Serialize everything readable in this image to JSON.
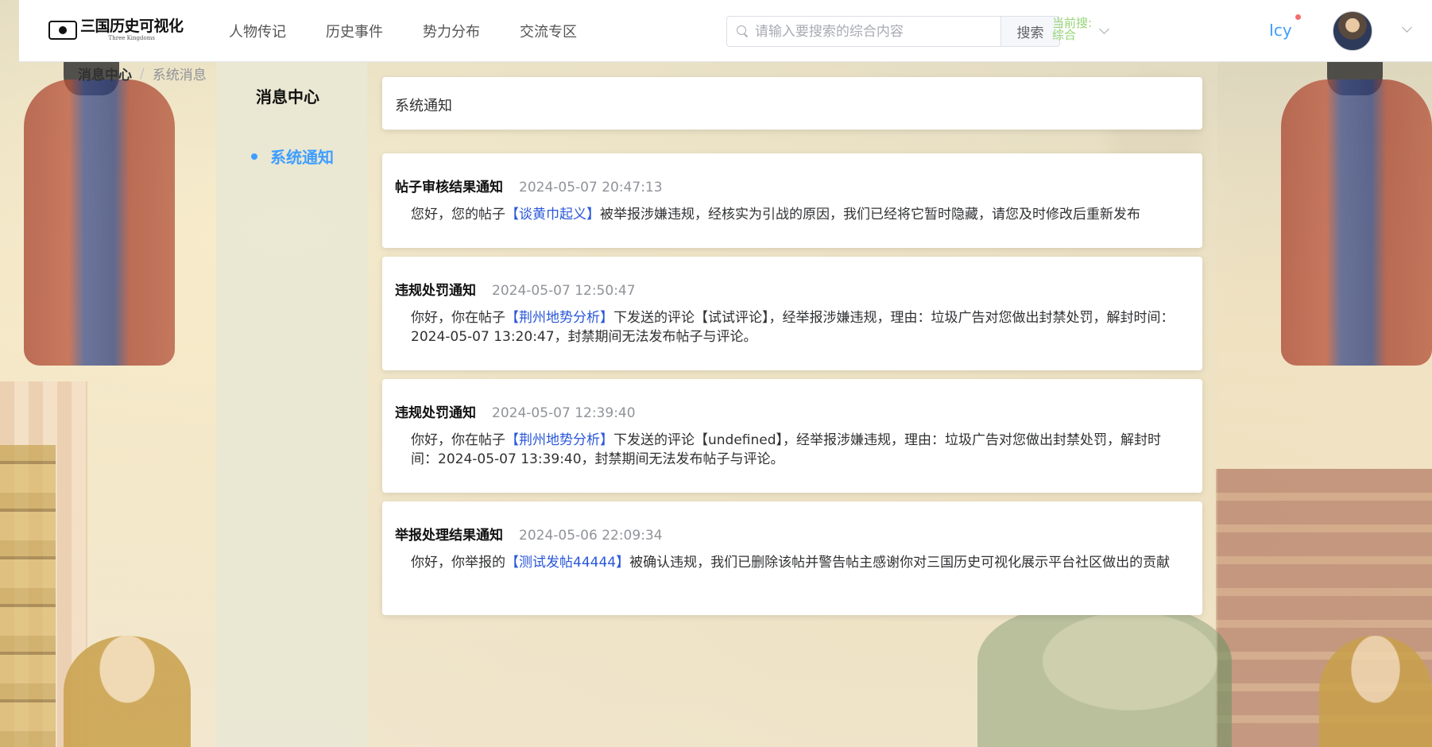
{
  "header": {
    "logo_text": "三国历史可视化",
    "logo_sub": "Three Kingdoms",
    "nav": [
      "人物传记",
      "历史事件",
      "势力分布",
      "交流专区"
    ],
    "search": {
      "placeholder": "请输入要搜索的综合内容",
      "button_label": "搜索",
      "scope_label": "当前搜:",
      "scope_value": "综合"
    },
    "username": "Icy"
  },
  "breadcrumb": [
    "消息中心",
    "系统消息"
  ],
  "breadcrumb_sep": "/",
  "sidebar": {
    "title": "消息中心",
    "items": [
      {
        "label": "系统通知",
        "active": true
      }
    ]
  },
  "main": {
    "title": "系统通知",
    "notices": [
      {
        "title": "帖子审核结果通知",
        "time": "2024-05-07 20:47:13",
        "pre": "您好，您的帖子",
        "link": "【谈黄巾起义】",
        "post": "被举报涉嫌违规，经核实为引战的原因，我们已经将它暂时隐藏，请您及时修改后重新发布"
      },
      {
        "title": "违规处罚通知",
        "time": "2024-05-07 12:50:47",
        "pre": "你好，你在帖子",
        "link": "【荆州地势分析】",
        "post": "下发送的评论【试试评论】，经举报涉嫌违规，理由：垃圾广告对您做出封禁处罚，解封时间：2024-05-07 13:20:47，封禁期间无法发布帖子与评论。"
      },
      {
        "title": "违规处罚通知",
        "time": "2024-05-07 12:39:40",
        "pre": "你好，你在帖子",
        "link": "【荆州地势分析】",
        "post": "下发送的评论【undefined】，经举报涉嫌违规，理由：垃圾广告对您做出封禁处罚，解封时间：2024-05-07 13:39:40，封禁期间无法发布帖子与评论。"
      },
      {
        "title": "举报处理结果通知",
        "time": "2024-05-06 22:09:34",
        "pre": "你好，你举报的",
        "link": "【测试发帖44444】",
        "post": "被确认违规，我们已删除该帖并警告帖主感谢你对三国历史可视化展示平台社区做出的贡献"
      }
    ]
  },
  "colors": {
    "accent": "#409eff",
    "link": "#2a57d9",
    "scope": "#95d475",
    "notif_dot": "#f56c6c"
  },
  "icons": [
    "logo-icon",
    "search-icon",
    "chevron-down-icon",
    "notification-dot-icon",
    "avatar"
  ]
}
